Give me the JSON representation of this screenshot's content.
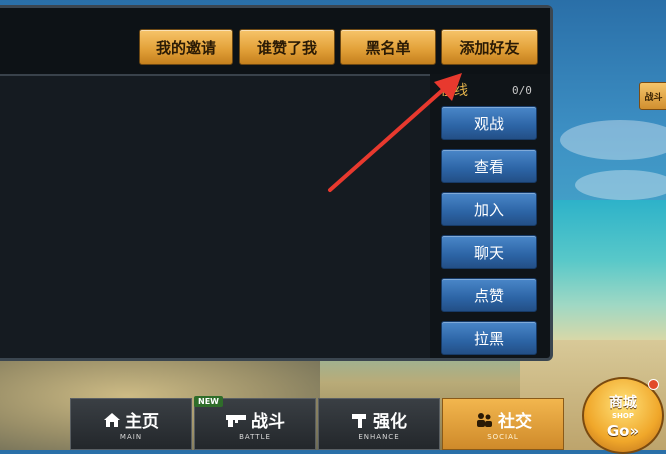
{
  "tabs": [
    "我的邀请",
    "谁赞了我",
    "黑名单",
    "添加好友"
  ],
  "online": {
    "label": "在线",
    "count": "0/0"
  },
  "actions": [
    "观战",
    "查看",
    "加入",
    "聊天",
    "点赞",
    "拉黑"
  ],
  "side_tab": "战斗",
  "nav": [
    {
      "label": "主页",
      "sub": "MAIN"
    },
    {
      "label": "战斗",
      "sub": "BATTLE",
      "badge": "NEW"
    },
    {
      "label": "强化",
      "sub": "ENHANCE"
    },
    {
      "label": "社交",
      "sub": "SOCIAL"
    }
  ],
  "shop": {
    "title": "商城",
    "sub": "SHOP",
    "go": "Go»"
  },
  "colors": {
    "tab_gold": "#e3a23a",
    "action_blue": "#2c64a5",
    "arrow_red": "#e8392e"
  }
}
